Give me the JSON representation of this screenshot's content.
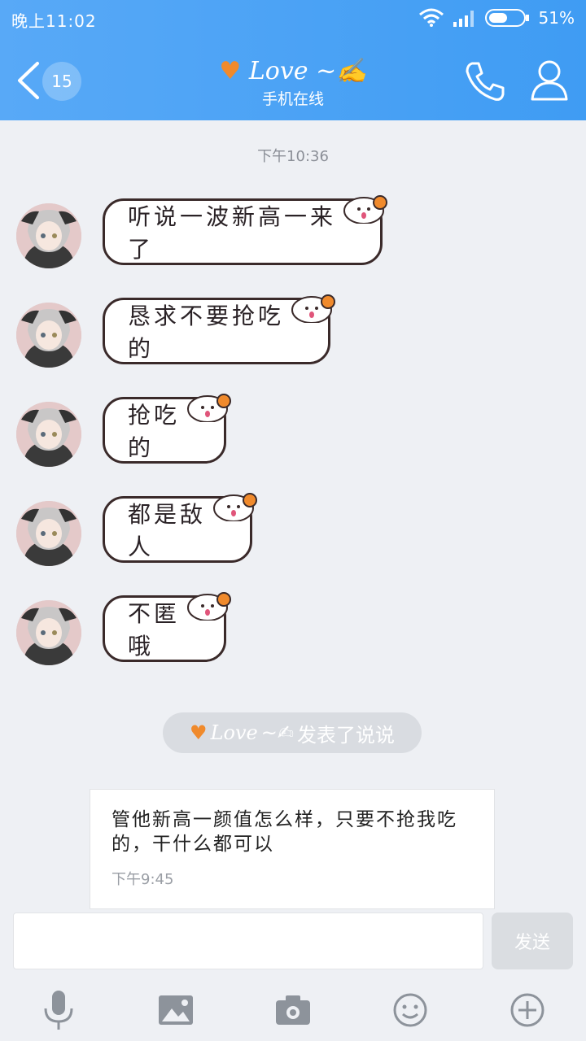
{
  "status": {
    "time": "晚上11:02",
    "battery": "51%"
  },
  "header": {
    "badge": "15",
    "name": "Love",
    "subtitle": "手机在线"
  },
  "time_separator": "下午10:36",
  "messages": [
    {
      "text": "听说一波新高一来了"
    },
    {
      "text": "恳求不要抢吃的"
    },
    {
      "text": "抢吃的"
    },
    {
      "text": "都是敌人"
    },
    {
      "text": "不匿哦"
    }
  ],
  "post_notice": {
    "name": "Love",
    "action": "发表了说说"
  },
  "post": {
    "text": "管他新高一颜值怎么样，只要不抢我吃的，干什么都可以",
    "time": "下午9:45"
  },
  "composer": {
    "send_label": "发送"
  },
  "colors": {
    "header": "#4aa3f5",
    "accent_heart": "#f08a2c"
  }
}
